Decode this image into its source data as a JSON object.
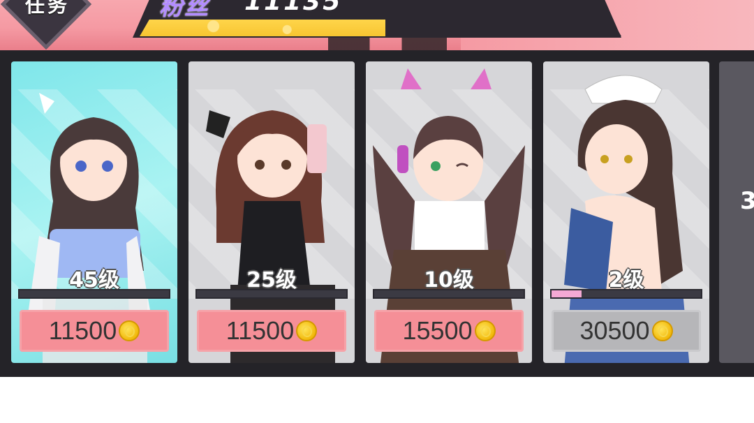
{
  "header": {
    "badge_label": "任务",
    "fans_label": "粉丝",
    "fans_value": "11135",
    "fans_progress": 0.51
  },
  "cards": [
    {
      "level": "45级",
      "price": "11500",
      "progress": 0.0,
      "selected": true,
      "price_state": "active"
    },
    {
      "level": "25级",
      "price": "11500",
      "progress": 0.0,
      "selected": false,
      "price_state": "active"
    },
    {
      "level": "10级",
      "price": "15500",
      "progress": 0.0,
      "selected": false,
      "price_state": "active"
    },
    {
      "level": "2级",
      "price": "30500",
      "progress": 0.2,
      "selected": false,
      "price_state": "locked"
    }
  ],
  "next_card_peek": "3",
  "icons": {
    "coin": "coin-icon"
  },
  "colors": {
    "price_active": "#f58f97",
    "price_locked": "#b6b6b9",
    "progress_fill": "#f4a9d4",
    "selected_card": "#7fe6ea"
  }
}
